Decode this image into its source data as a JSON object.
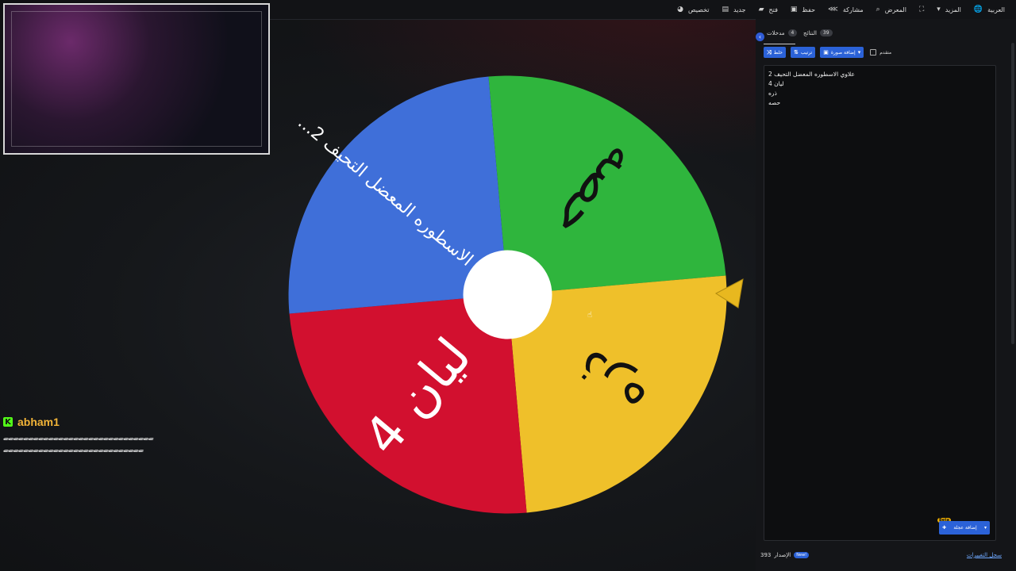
{
  "menu": [
    {
      "name": "language-menu",
      "label": "العربية",
      "icon": "globe-icon",
      "glyph": "🌐"
    },
    {
      "name": "more-menu",
      "label": "المزيد",
      "icon": "caret-down-icon",
      "glyph": "▾"
    },
    {
      "name": "fullscreen-button",
      "label": "",
      "icon": "fullscreen-icon",
      "glyph": "⛶"
    },
    {
      "name": "gallery-button",
      "label": "المعرض",
      "icon": "search-icon",
      "glyph": "⌕"
    },
    {
      "name": "share-button",
      "label": "مشاركة",
      "icon": "share-icon",
      "glyph": "⋘"
    },
    {
      "name": "save-button",
      "label": "حفظ",
      "icon": "save-icon",
      "glyph": "▣"
    },
    {
      "name": "open-button",
      "label": "فتح",
      "icon": "folder-icon",
      "glyph": "▰"
    },
    {
      "name": "new-button",
      "label": "جديد",
      "icon": "file-icon",
      "glyph": "▤"
    },
    {
      "name": "customize-button",
      "label": "تخصيص",
      "icon": "palette-icon",
      "glyph": "◕"
    }
  ],
  "wheel": {
    "slices": [
      {
        "label": "حصه",
        "color": "#2fb53d"
      },
      {
        "label": "ذره",
        "color": "#efc02a"
      },
      {
        "label": "ليان 4",
        "color": "#d2102f"
      },
      {
        "label": "...علاوي الاسطوره المعضل التحيف 2",
        "color": "#3f6fd9"
      }
    ],
    "hub_color": "#ffffff",
    "pointer_color": "#e8b81f"
  },
  "chat": {
    "username": "abham1",
    "platform_icon": "K",
    "message": "ﮯﮯﮯﮯﮯﮯﮯﮯﮯﮯﮯﮯﮯﮯﮯﮯﮯﮯﮯﮯﮯﮯﮯﮯﮯﮯﮯﮯﮯﮯﮯﮯﮯﮯﮯﮯﮯﮯﮯﮯﮯﮯﮯﮯﮯﮯﮯﮯﮯﮯﮯﮯﮯﮯﮯﮯﮯﮯ"
  },
  "panel": {
    "tabs": {
      "entries_label": "مدخلات",
      "entries_count": "4",
      "results_label": "النتائج",
      "results_count": "39"
    },
    "toolbar": {
      "shuffle_label": "خلط",
      "sort_label": "ترتيب",
      "add_image_label": "إضافة صورة",
      "advanced_label": "متقدم"
    },
    "entries": [
      "علاوي الاسطوره المعضل التحيف 2",
      "ليان 4",
      "ذره",
      "حصه"
    ],
    "add_wheel_label": "إضافة عجلة",
    "beta_label": "Beta",
    "version_label": "الإصدار",
    "version_number": "393",
    "new_label": "New!",
    "changelog_label": "سجل التغييرات"
  }
}
